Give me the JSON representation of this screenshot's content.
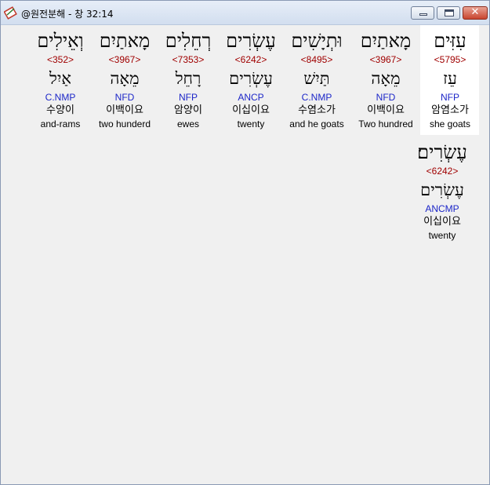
{
  "window": {
    "title": "@원전분해 - 창 32:14",
    "close_glyph": "✕"
  },
  "words": [
    {
      "hebrew": "עִזִּים",
      "strong": "<5795>",
      "lemma": "עֵז",
      "morph": "NFP",
      "korean": "암염소가",
      "english": "she goats"
    },
    {
      "hebrew": "מָאתַיִם",
      "strong": "<3967>",
      "lemma": "מֵאָה",
      "morph": "NFD",
      "korean": "이백이요",
      "english": "Two hundred"
    },
    {
      "hebrew": "וּתְיָשִׁים",
      "strong": "<8495>",
      "lemma": "תַּיִשׁ",
      "morph": "C.NMP",
      "korean": "수염소가",
      "english": "and he goats"
    },
    {
      "hebrew": "עֶשְׂרִים",
      "strong": "<6242>",
      "lemma": "עֶשְׂרִים",
      "morph": "ANCP",
      "korean": "이십이요",
      "english": "twenty"
    },
    {
      "hebrew": "רְחֵלִים",
      "strong": "<7353>",
      "lemma": "רָחֵל",
      "morph": "NFP",
      "korean": "암양이",
      "english": "ewes"
    },
    {
      "hebrew": "מָאתַיִם",
      "strong": "<3967>",
      "lemma": "מֵאָה",
      "morph": "NFD",
      "korean": "이백이요",
      "english": "two hunderd"
    },
    {
      "hebrew": "וְאֵילִים",
      "strong": "<352>",
      "lemma": "אַיִל",
      "morph": "C.NMP",
      "korean": "수양이",
      "english": "and-rams"
    },
    {
      "hebrew": "עֶשְׂרִים׃",
      "strong": "<6242>",
      "lemma": "עֶשְׂרִים",
      "morph": "ANCMP",
      "korean": "이십이요",
      "english": "twenty"
    }
  ]
}
